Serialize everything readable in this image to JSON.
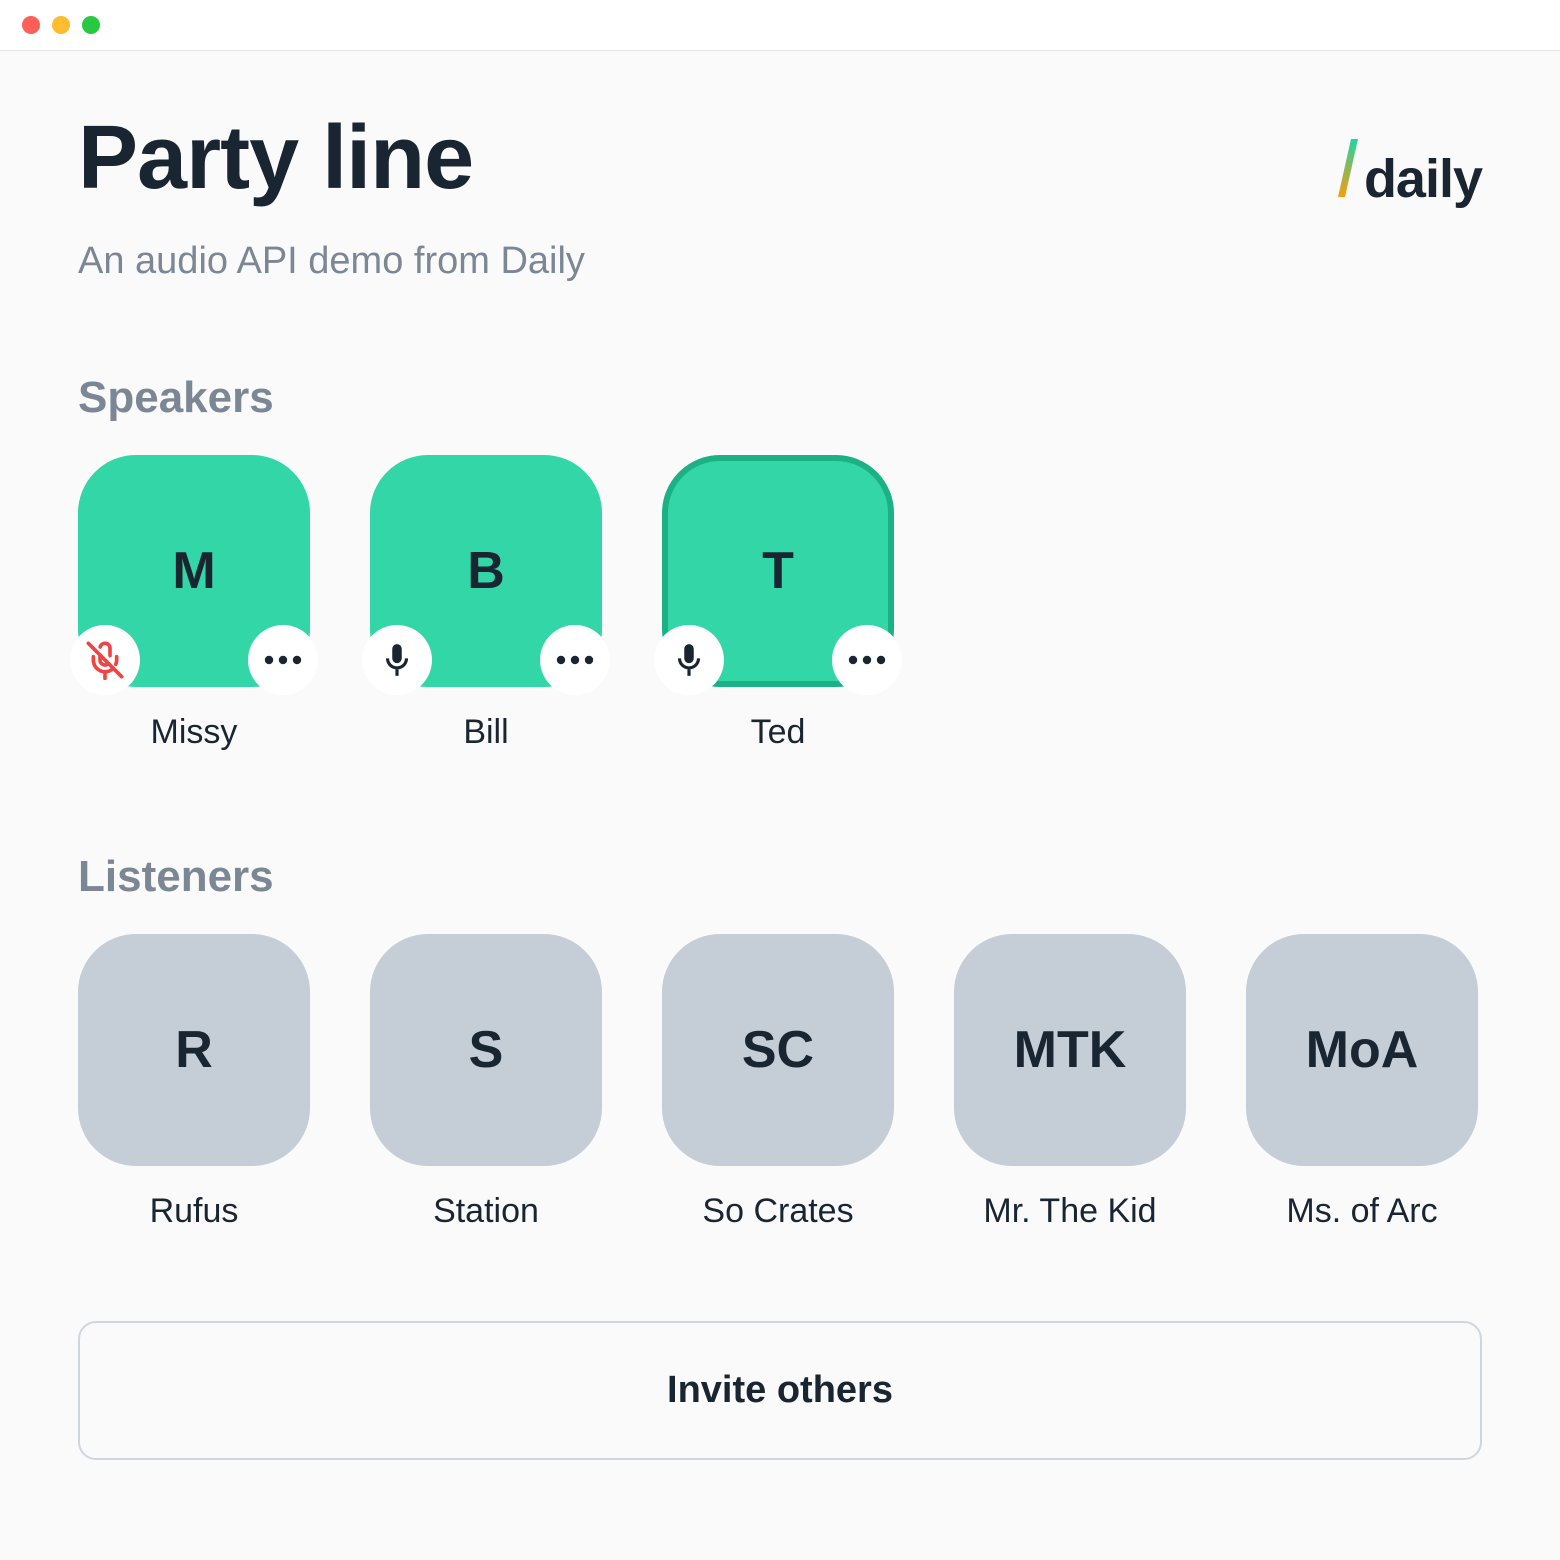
{
  "header": {
    "title": "Party line",
    "subtitle": "An audio API demo from Daily",
    "logo_text": "daily"
  },
  "sections": {
    "speakers_label": "Speakers",
    "listeners_label": "Listeners"
  },
  "speakers": [
    {
      "initial": "M",
      "name": "Missy",
      "muted": true,
      "active": false
    },
    {
      "initial": "B",
      "name": "Bill",
      "muted": false,
      "active": false
    },
    {
      "initial": "T",
      "name": "Ted",
      "muted": false,
      "active": true
    }
  ],
  "listeners": [
    {
      "initial": "R",
      "name": "Rufus"
    },
    {
      "initial": "S",
      "name": "Station"
    },
    {
      "initial": "SC",
      "name": "So Crates"
    },
    {
      "initial": "MTK",
      "name": "Mr. The Kid"
    },
    {
      "initial": "MoA",
      "name": "Ms. of Arc"
    }
  ],
  "invite": {
    "label": "Invite others"
  },
  "colors": {
    "speaker_bg": "#33d6a6",
    "speaker_active_border": "#1bb185",
    "listener_bg": "#c5cdd6",
    "muted_icon": "#ef4444",
    "text_dark": "#1a2532",
    "text_muted": "#7b8794"
  }
}
